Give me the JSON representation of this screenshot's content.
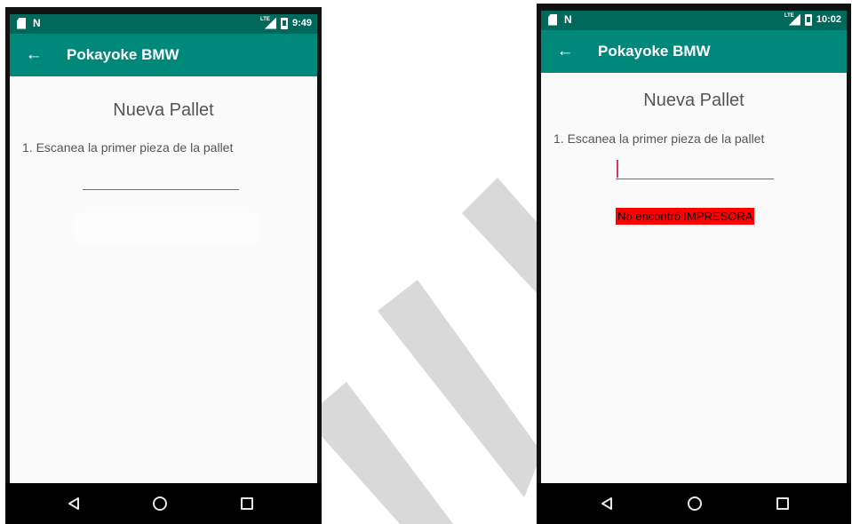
{
  "colors": {
    "status_bar": "#00695c",
    "app_bar": "#00897b",
    "accent_underline": "#e0336b",
    "error_background": "#ff0000",
    "nav_bar": "#000000",
    "screen_background": "#fafafa"
  },
  "icons": {
    "back": "arrow-left-icon",
    "sim": "sim-card-icon",
    "nfc": "nfc-icon",
    "signal": "signal-lte-icon",
    "battery": "battery-icon",
    "nav_back": "triangle-back-icon",
    "nav_home": "circle-home-icon",
    "nav_recents": "square-recents-icon"
  },
  "left_screen": {
    "status": {
      "nfc_glyph": "N",
      "network_label": "LTE",
      "time": "9:49"
    },
    "app_bar": {
      "back_glyph": "←",
      "title": "Pokayoke BMW"
    },
    "content": {
      "title": "Nueva Pallet",
      "instruction": "1. Escanea la primer pieza de la pallet",
      "scan_value": ""
    }
  },
  "right_screen": {
    "status": {
      "nfc_glyph": "N",
      "network_label": "LTE",
      "time": "10:02"
    },
    "app_bar": {
      "back_glyph": "←",
      "title": "Pokayoke BMW"
    },
    "content": {
      "title": "Nueva Pallet",
      "instruction": "1. Escanea la primer pieza de la pallet",
      "scan_value": "",
      "error_message": "No encontró IMPRESORA"
    }
  }
}
